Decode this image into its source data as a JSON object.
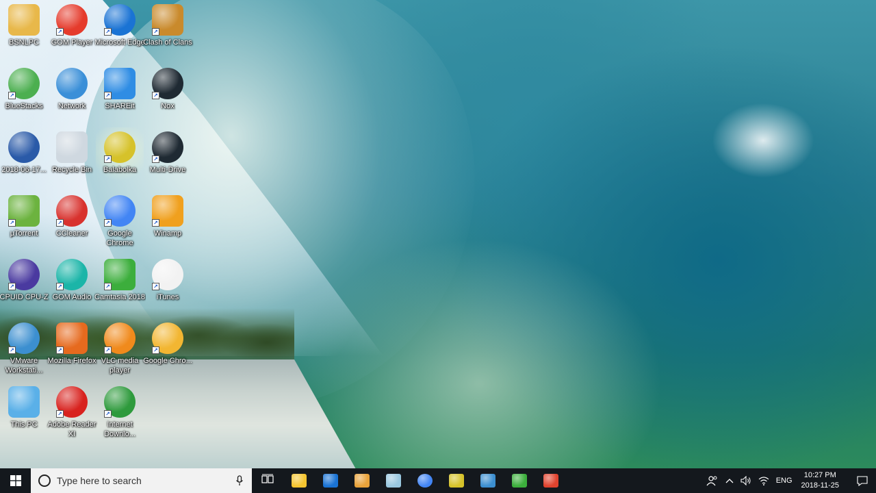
{
  "desktop": {
    "icons": [
      {
        "label": "BSNLPC",
        "icon": "user-folder-icon",
        "color": "#e8b84a",
        "shortcut": false
      },
      {
        "label": "GOM Player",
        "icon": "gom-player-icon",
        "color": "#e53b2c",
        "shortcut": true
      },
      {
        "label": "Microsoft Edge",
        "icon": "edge-icon",
        "color": "#1a73d4",
        "shortcut": true
      },
      {
        "label": "Clash of Clans",
        "icon": "clash-of-clans-icon",
        "color": "#c98a2c",
        "shortcut": true
      },
      {
        "label": "BlueStacks",
        "icon": "bluestacks-icon",
        "color": "#4caf50",
        "shortcut": true
      },
      {
        "label": "Network",
        "icon": "network-icon",
        "color": "#3a8fd8",
        "shortcut": false
      },
      {
        "label": "SHAREit",
        "icon": "shareit-icon",
        "color": "#2f8de4",
        "shortcut": true
      },
      {
        "label": "Nox",
        "icon": "nox-icon",
        "color": "#1f2a33",
        "shortcut": true
      },
      {
        "label": "2018-06-17...",
        "icon": "video-file-icon",
        "color": "#2a5aa8",
        "shortcut": false
      },
      {
        "label": "Recycle Bin",
        "icon": "recycle-bin-icon",
        "color": "#cfd8e0",
        "shortcut": false
      },
      {
        "label": "Balabolka",
        "icon": "balabolka-icon",
        "color": "#d6c22a",
        "shortcut": true
      },
      {
        "label": "Multi-Drive",
        "icon": "multi-drive-icon",
        "color": "#1f2a33",
        "shortcut": true
      },
      {
        "label": "µTorrent",
        "icon": "utorrent-icon",
        "color": "#6cb33f",
        "shortcut": true
      },
      {
        "label": "CCleaner",
        "icon": "ccleaner-icon",
        "color": "#d8322e",
        "shortcut": true
      },
      {
        "label": "Google Chrome",
        "icon": "chrome-icon",
        "color": "#4285f4",
        "shortcut": true
      },
      {
        "label": "Winamp",
        "icon": "winamp-icon",
        "color": "#f0a01e",
        "shortcut": true
      },
      {
        "label": "CPUID CPU-Z",
        "icon": "cpuz-icon",
        "color": "#4a3aa0",
        "shortcut": true
      },
      {
        "label": "GOM Audio",
        "icon": "gom-audio-icon",
        "color": "#1bb5a8",
        "shortcut": true
      },
      {
        "label": "Camtasia 2018",
        "icon": "camtasia-icon",
        "color": "#3cae3c",
        "shortcut": true
      },
      {
        "label": "iTunes",
        "icon": "itunes-icon",
        "color": "#f2f2f2",
        "shortcut": true
      },
      {
        "label": "VMware Workstati...",
        "icon": "vmware-icon",
        "color": "#3c8fd0",
        "shortcut": true
      },
      {
        "label": "Mozilla Firefox",
        "icon": "firefox-icon",
        "color": "#e66a1e",
        "shortcut": true
      },
      {
        "label": "VLC media player",
        "icon": "vlc-icon",
        "color": "#f08a1c",
        "shortcut": true
      },
      {
        "label": "Google Chro...",
        "icon": "chrome-canary-icon",
        "color": "#f2b632",
        "shortcut": true
      },
      {
        "label": "This PC",
        "icon": "this-pc-icon",
        "color": "#5ab0e8",
        "shortcut": false
      },
      {
        "label": "Adobe Reader XI",
        "icon": "adobe-reader-icon",
        "color": "#d8221e",
        "shortcut": true
      },
      {
        "label": "Internet Downlo...",
        "icon": "idm-icon",
        "color": "#2e9a3c",
        "shortcut": true
      }
    ]
  },
  "taskbar": {
    "search_placeholder": "Type here to search",
    "pinned": [
      {
        "name": "task-view",
        "icon": "task-view-icon"
      },
      {
        "name": "file-explorer",
        "icon": "folder-icon",
        "color": "#f4c430"
      },
      {
        "name": "edge",
        "icon": "edge-icon",
        "color": "#1a73d4"
      },
      {
        "name": "media-player",
        "icon": "media-player-icon",
        "color": "#e8a23a"
      },
      {
        "name": "eraser-app",
        "icon": "eraser-icon",
        "color": "#9ac8e0"
      },
      {
        "name": "chrome",
        "icon": "chrome-icon",
        "color": "#4285f4"
      },
      {
        "name": "balabolka",
        "icon": "balabolka-icon",
        "color": "#d6c22a"
      },
      {
        "name": "vmware",
        "icon": "vmware-icon",
        "color": "#3c8fd0"
      },
      {
        "name": "camtasia",
        "icon": "camtasia-icon",
        "color": "#3cae3c"
      },
      {
        "name": "camtasia-recorder",
        "icon": "recorder-icon",
        "color": "#e0432e"
      }
    ],
    "tray": {
      "language": "ENG",
      "time": "10:27 PM",
      "date": "2018-11-25"
    }
  }
}
